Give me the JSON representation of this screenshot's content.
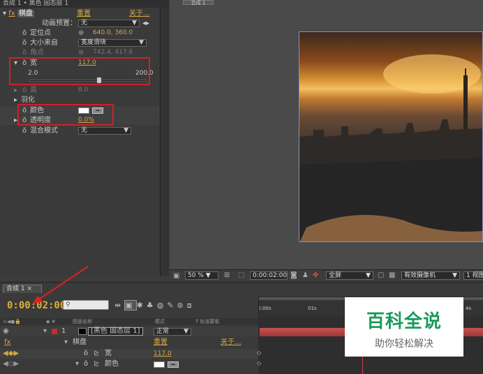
{
  "effect_panel": {
    "header": "合成 1 • 黑色 固态层 1",
    "fx_label": "fx",
    "effect_name": "棋盘",
    "reset": "重置",
    "about": "关于...",
    "preset_label": "动画预置：",
    "preset_value": "无",
    "anchor_label": "定位点",
    "anchor_value": "640.0, 360.0",
    "size_from_label": "大小来自",
    "size_from_value": "宽度滑块",
    "corner_label": "角点",
    "corner_value": "742.4, 417.6",
    "width_label": "宽",
    "width_value": "117.0",
    "slider_min": "2.0",
    "slider_max": "200.0",
    "height_label": "高",
    "height_value": "8.0",
    "feather_label": "羽化",
    "color_label": "颜色",
    "opacity_label": "透明度",
    "opacity_value": "0.0%",
    "blend_label": "混合模式",
    "blend_value": "无",
    "swatch_color": "#ffffff"
  },
  "viewer": {
    "tab": "合成 1",
    "zoom": "50 %",
    "timecode": "0:00:02:00",
    "resolution": "全屏",
    "camera": "有效摄像机",
    "views": "1 视图"
  },
  "composition": {
    "tab": "合成 1",
    "timecode": "0:00:02:00",
    "col_name": "图层名称",
    "col_mode": "模式",
    "col_trkmat": "T  轨道蒙板",
    "layer_num": "1",
    "layer_name": "[黑色 固态层 1]",
    "layer_mode": "正常",
    "fx": "fx",
    "effect": "棋盘",
    "reset": "重置",
    "about": "关于...",
    "width_label": "宽",
    "width_value": "117.0",
    "color_label": "颜色",
    "ruler_start": "):00s",
    "ruler_1s": "01s",
    "ruler_4s": "4s"
  },
  "watermark": {
    "title": "百科全说",
    "subtitle": "助你轻松解决"
  },
  "accent_color": "#d4a840",
  "highlight_color": "#d0202a"
}
